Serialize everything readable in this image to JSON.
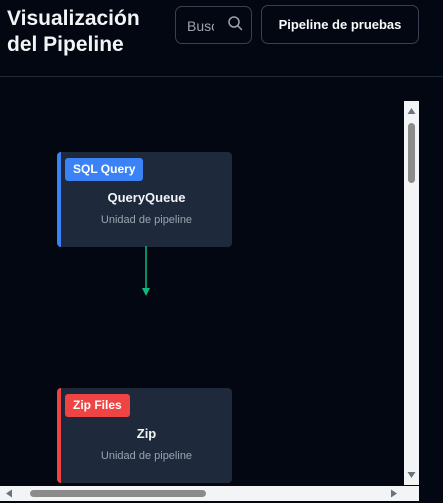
{
  "header": {
    "title": "Visualización del Pipeline",
    "search_placeholder": "Buscar",
    "test_button_label": "Pipeline de pruebas"
  },
  "nodes": [
    {
      "badge": "SQL Query",
      "name": "QueryQueue",
      "subtitle": "Unidad de pipeline",
      "accent": "#3b82f6"
    },
    {
      "badge": "Zip Files",
      "name": "Zip",
      "subtitle": "Unidad de pipeline",
      "accent": "#ef4444"
    }
  ],
  "edge_color": "#10b981",
  "icons": {
    "search": "search-icon"
  }
}
